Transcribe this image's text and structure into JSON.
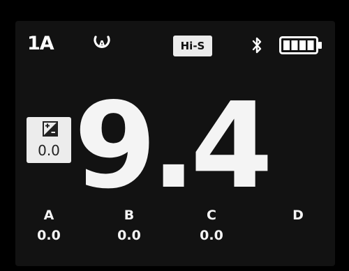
{
  "status_bar": {
    "channel": "1A",
    "mode_icon": "auto-mode-icon",
    "sync_mode": "Hi-S",
    "bluetooth_icon": "bluetooth-icon",
    "battery_icon": "battery-full-icon",
    "battery_level": 1.0
  },
  "exposure_compensation": {
    "icon": "exposure-compensation-icon",
    "value": "0.0"
  },
  "power": {
    "value": "9.4"
  },
  "groups": [
    {
      "name": "A",
      "value": "0.0"
    },
    {
      "name": "B",
      "value": "0.0"
    },
    {
      "name": "C",
      "value": "0.0"
    },
    {
      "name": "D",
      "value": ""
    }
  ],
  "colors": {
    "background": "#000000",
    "screen": "#121212",
    "foreground": "#f4f4f4",
    "badge_background": "#ececec",
    "badge_text": "#111111"
  }
}
